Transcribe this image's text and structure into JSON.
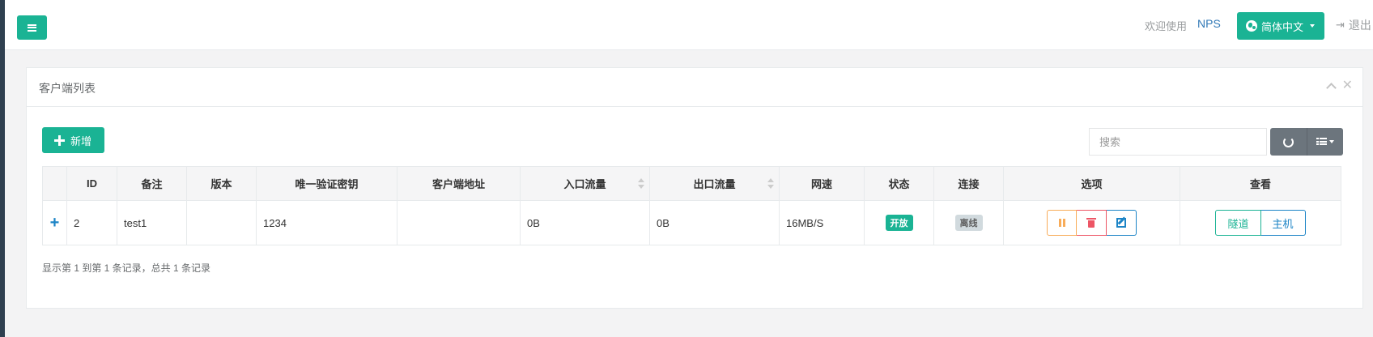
{
  "topbar": {
    "welcome": "欢迎使用",
    "brand": "NPS",
    "language": "简体中文",
    "logout": "退出"
  },
  "panel": {
    "title": "客户端列表"
  },
  "toolbar": {
    "add_label": "新增",
    "search_placeholder": "搜索"
  },
  "table": {
    "headers": {
      "id": "ID",
      "remark": "备注",
      "version": "版本",
      "vkey": "唯一验证密钥",
      "addr": "客户端地址",
      "inflow": "入口流量",
      "outflow": "出口流量",
      "rate": "网速",
      "status": "状态",
      "conn": "连接",
      "options": "选项",
      "view": "查看"
    },
    "rows": [
      {
        "id": "2",
        "remark": "test1",
        "version": "",
        "vkey": "1234",
        "addr": "",
        "inflow": "0B",
        "outflow": "0B",
        "rate": "16MB/S",
        "status": "开放",
        "conn": "离线",
        "tunnel_label": "隧道",
        "host_label": "主机"
      }
    ]
  },
  "pagination": {
    "info": "显示第 1 到第 1 条记录，总共 1 条记录"
  },
  "colors": {
    "primary": "#1ab394",
    "link": "#337ab7",
    "warning": "#f8ac59",
    "danger": "#ed5565",
    "info": "#1c84c6"
  }
}
